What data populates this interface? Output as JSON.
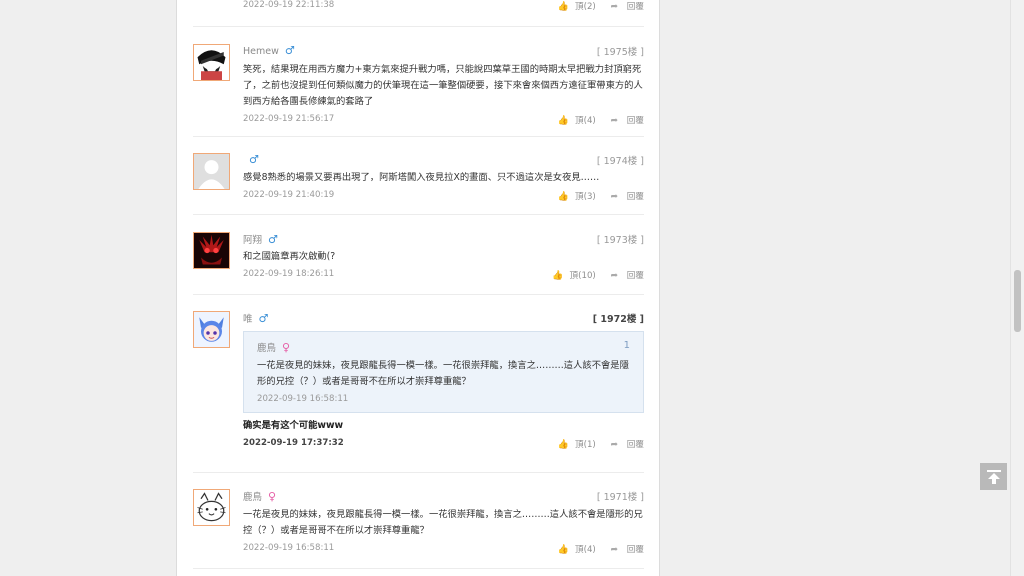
{
  "top_fragment": {
    "timestamp": "2022-09-19 22:11:38",
    "like_label": "頂(2)",
    "reply_label": "回覆"
  },
  "comments": [
    {
      "username": "Hemew",
      "gender": "♂",
      "floor": "[ 1975楼 ]",
      "text": "笑死，結果現在用西方魔力+東方氣來提升戰力嗎，只能說四葉草王國的時期太早把戰力封頂窮死了，之前也沒提到任何類似魔力的伏筆現在這一筆整個硬要，接下來會來個西方遠征軍帶東方的人到西方給各團長修練氣的套路了",
      "timestamp": "2022-09-19 21:56:17",
      "like_label": "頂(4)",
      "reply_label": "回覆"
    },
    {
      "username": "",
      "gender": "♂",
      "floor": "[ 1974楼 ]",
      "text": "感覺8熟悉的場景又要再出現了，阿斯塔闖入夜見拉X的畫面、只不過這次是女夜見……",
      "timestamp": "2022-09-19 21:40:19",
      "like_label": "頂(3)",
      "reply_label": "回覆"
    },
    {
      "username": "阿翔",
      "gender": "♂",
      "floor": "[ 1973楼 ]",
      "text": "和之國篇章再次啟動(?",
      "timestamp": "2022-09-19 18:26:11",
      "like_label": "頂(10)",
      "reply_label": "回覆"
    },
    {
      "username": "唯",
      "gender": "♂",
      "floor": "[ 1972楼 ]",
      "quote": {
        "username": "鹿鳥",
        "gender": "♀",
        "number": "1",
        "text": "一花是夜見的妹妹，夜見跟龍長得一模一樣。一花很崇拜龍，換言之………這人該不會是隱形的兄控（？）或者是哥哥不在所以才崇拜尊重龍？",
        "timestamp": "2022-09-19 16:58:11"
      },
      "text": "确实是有这个可能www",
      "timestamp": "2022-09-19 17:37:32",
      "like_label": "頂(1)",
      "reply_label": "回覆"
    },
    {
      "username": "鹿鳥",
      "gender": "♀",
      "floor": "[ 1971楼 ]",
      "text": "一花是夜見的妹妹，夜見跟龍長得一模一樣。一花很崇拜龍，換言之………這人該不會是隱形的兄控（？）或者是哥哥不在所以才崇拜尊重龍？",
      "timestamp": "2022-09-19 16:58:11",
      "like_label": "頂(4)",
      "reply_label": "回覆"
    }
  ],
  "icons": {
    "like": "thumbs-up-icon",
    "reply": "reply-arrow-icon",
    "back_to_top": "arrow-up-icon"
  },
  "colors": {
    "avatar_border": "#f0a877",
    "male": "#3a8fd6",
    "female": "#e65ea6",
    "quote_bg": "#edf3fa"
  }
}
